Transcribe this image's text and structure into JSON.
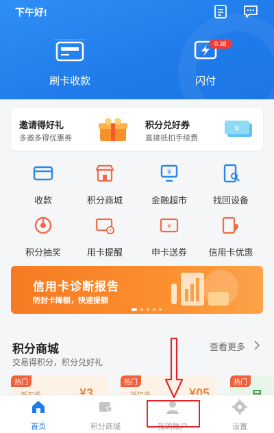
{
  "header": {
    "greeting": "下午好!",
    "icons": [
      "list-icon",
      "message-icon"
    ],
    "actions": [
      {
        "id": "swipe",
        "label": "刷卡收款",
        "icon": "card-reader-icon"
      },
      {
        "id": "flash",
        "label": "闪付",
        "icon": "flash-pay-icon",
        "badge": "0.38"
      }
    ]
  },
  "promo": {
    "left": {
      "title": "邀请得好礼",
      "sub": "多邀多得优惠券",
      "icon": "gift-box-icon"
    },
    "right": {
      "title": "积分兑好券",
      "sub": "直接抵扣手续费",
      "icon": "coupon-ticket-icon"
    }
  },
  "grid": [
    {
      "label": "收款",
      "icon": "card-icon"
    },
    {
      "label": "积分商城",
      "icon": "store-icon"
    },
    {
      "label": "金融超市",
      "icon": "finance-market-icon"
    },
    {
      "label": "找回设备",
      "icon": "find-device-icon"
    },
    {
      "label": "积分抽奖",
      "icon": "lottery-disc-icon"
    },
    {
      "label": "用卡提醒",
      "icon": "card-reminder-icon"
    },
    {
      "label": "申卡送券",
      "icon": "apply-card-icon"
    },
    {
      "label": "信用卡优惠",
      "icon": "credit-card-offer-icon"
    }
  ],
  "banner": {
    "title": "信用卡诊断报告",
    "sub": "防封卡降额，快速提额",
    "dots": 5,
    "active_dot": 0
  },
  "mall": {
    "title": "积分商城",
    "sub": "交易得积分，积分兑好礼",
    "more": "查看更多",
    "cards": [
      {
        "tag": "热门",
        "text": "抵扣券",
        "num": "¥3"
      },
      {
        "tag": "热门",
        "text": "抵扣券",
        "num": "¥05"
      },
      {
        "tag": "热门",
        "text": "",
        "num": "月"
      }
    ]
  },
  "tabbar": [
    {
      "label": "首页",
      "icon": "home-icon",
      "active": true
    },
    {
      "label": "积分商城",
      "icon": "mall-tab-icon",
      "active": false
    },
    {
      "label": "我的账户",
      "icon": "account-icon",
      "active": false
    },
    {
      "label": "设置",
      "icon": "settings-gear-icon",
      "active": false
    }
  ],
  "colors": {
    "brand_blue": "#1f7bea",
    "accent_orange": "#f77a23",
    "icon_blue": "#2d87e6",
    "icon_red": "#f06a4a",
    "annotation_red": "#e0262b"
  }
}
